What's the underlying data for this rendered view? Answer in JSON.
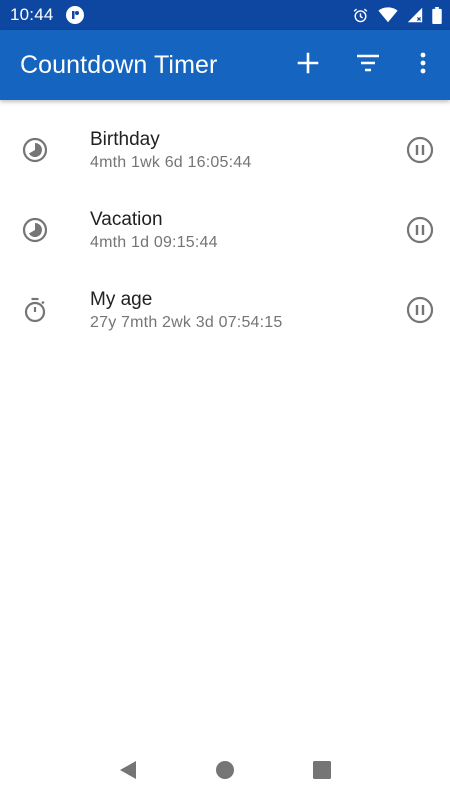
{
  "status_bar": {
    "time": "10:44"
  },
  "app_bar": {
    "title": "Countdown Timer",
    "actions": [
      "add-icon",
      "filter-icon",
      "more-vert-icon"
    ]
  },
  "timers": [
    {
      "name": "Birthday",
      "remaining": "4mth 1wk 6d 16:05:44",
      "icon": "countdown-clock-icon"
    },
    {
      "name": "Vacation",
      "remaining": "4mth 1d 09:15:44",
      "icon": "countdown-clock-icon"
    },
    {
      "name": "My age",
      "remaining": "27y 7mth 2wk 3d 07:54:15",
      "icon": "stopwatch-icon"
    }
  ],
  "colors": {
    "status_bar": "#0d47a1",
    "app_bar": "#1565c0",
    "icon_gray": "#757575",
    "text_primary": "#212121",
    "text_secondary": "#757575"
  }
}
